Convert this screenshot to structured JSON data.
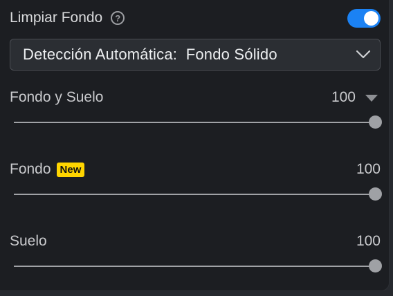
{
  "header": {
    "title": "Limpiar Fondo",
    "help_icon": "question-circle-icon",
    "toggle_on": true,
    "toggle_color": "#1b82f4"
  },
  "detection_select": {
    "value": "Detección Automática:  Fondo Sólido",
    "icon": "chevron-down-icon"
  },
  "sliders": [
    {
      "label": "Fondo y Suelo",
      "value": "100",
      "fraction": 1.0,
      "has_caret": true
    },
    {
      "label": "Fondo",
      "badge": "New",
      "value": "100",
      "fraction": 1.0
    },
    {
      "label": "Suelo",
      "value": "100",
      "fraction": 1.0
    }
  ],
  "colors": {
    "badge": "#ffd500",
    "panel_bg": "#1c1e22"
  }
}
